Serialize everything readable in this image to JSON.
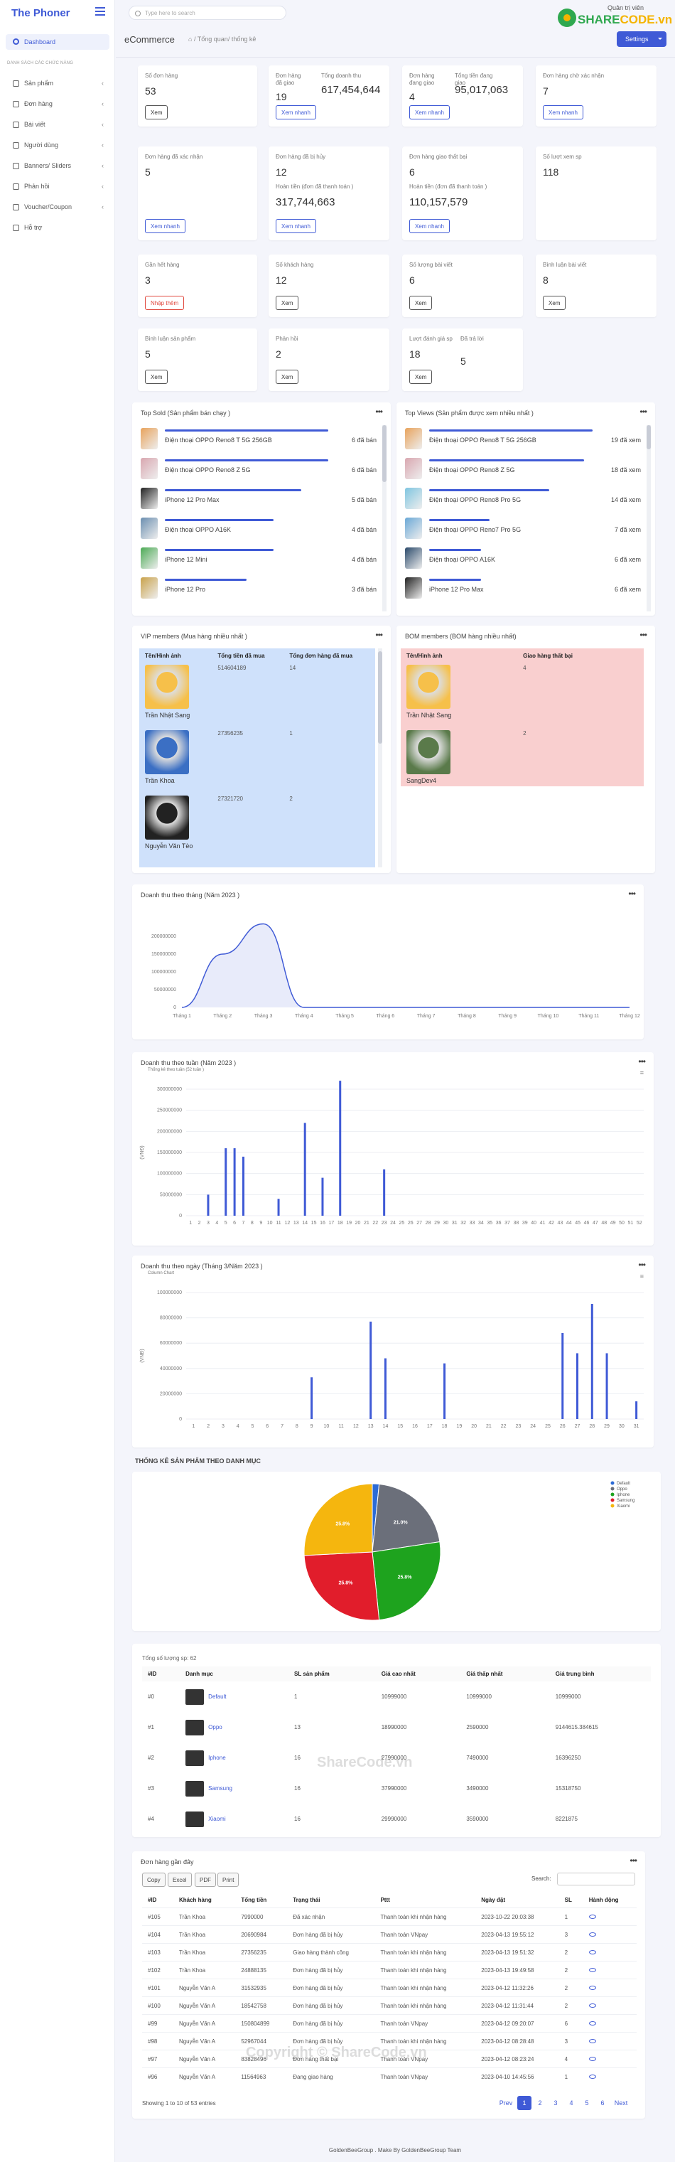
{
  "brand": "The Phoner",
  "search_placeholder": "Type here to search",
  "logo": {
    "top": "Quản trị viên",
    "left": "SHARE",
    "right": "CODE.vn"
  },
  "sidebar": {
    "dashboard": "Dashboard",
    "heading": "Danh sách các chức năng",
    "items": [
      {
        "label": "Sản phẩm",
        "chev": true
      },
      {
        "label": "Đơn hàng",
        "chev": true
      },
      {
        "label": "Bài viết",
        "chev": true
      },
      {
        "label": "Người dùng",
        "chev": true
      },
      {
        "label": "Banners/ Sliders",
        "chev": true
      },
      {
        "label": "Phản hồi",
        "chev": true
      },
      {
        "label": "Voucher/Coupon",
        "chev": true
      },
      {
        "label": "Hỗ trợ",
        "chev": false
      }
    ]
  },
  "header": {
    "title": "eCommerce",
    "crumb": "Tổng quan/ thống kê",
    "settings": "Settings"
  },
  "stats": [
    {
      "label": "Số đơn hàng",
      "value": "53",
      "btn": "Xem",
      "btn_style": "dark"
    },
    {
      "label": "Đơn hàng\nđã giao",
      "value": "19",
      "label2": "Tổng doanh thu",
      "value2": "617,454,644",
      "btn": "Xem nhanh",
      "btn_style": "blue"
    },
    {
      "label": "Đơn hàng\nđang giao",
      "value": "4",
      "label2": "Tổng tiền đang\ngiao",
      "value2": "95,017,063",
      "btn": "Xem nhanh",
      "btn_style": "blue"
    },
    {
      "label": "Đơn hàng chờ xác nhận",
      "value": "7",
      "btn": "Xem nhanh",
      "btn_style": "blue"
    },
    {
      "label": "Đơn hàng đã xác nhận",
      "value": "5",
      "btn": "Xem nhanh",
      "btn_style": "blue"
    },
    {
      "label": "Đơn hàng đã bị hủy",
      "value": "12",
      "label2": "Hoàn tiền (đơn đã thanh toán )",
      "value2": "317,744,663",
      "btn": "Xem nhanh",
      "btn_style": "blue"
    },
    {
      "label": "Đơn hàng giao thất bại",
      "value": "6",
      "label2": "Hoàn tiền (đơn đã thanh toán )",
      "value2": "110,157,579",
      "btn": "Xem nhanh",
      "btn_style": "blue"
    },
    {
      "label": "Số lượt xem sp",
      "value": "118"
    },
    {
      "label": "Gần hết hàng",
      "value": "3",
      "btn": "Nhập thêm",
      "btn_style": "red"
    },
    {
      "label": "Số khách hàng",
      "value": "12",
      "btn": "Xem",
      "btn_style": "dark"
    },
    {
      "label": "Số lượng bài viết",
      "value": "6",
      "btn": "Xem",
      "btn_style": "dark"
    },
    {
      "label": "Bình luận bài viết",
      "value": "8",
      "btn": "Xem",
      "btn_style": "dark"
    },
    {
      "label": "Bình luận sản phẩm",
      "value": "5",
      "btn": "Xem",
      "btn_style": "dark"
    },
    {
      "label": "Phản hồi",
      "value": "2",
      "btn": "Xem",
      "btn_style": "dark"
    },
    {
      "label": "Lượt đánh giá sp",
      "value": "18",
      "label2": "Đã trả lời",
      "value2": "5",
      "btn": "Xem",
      "btn_style": "dark"
    }
  ],
  "top_sold": {
    "title": "Top Sold (Sản phẩm bán chạy )",
    "unit": "đã bán",
    "items": [
      {
        "name": "Điện thoại OPPO Reno8 T 5G 256GB",
        "value": 6,
        "label": "6 đã bán",
        "color": "#e8a35c"
      },
      {
        "name": "Điện thoại OPPO Reno8 Z 5G",
        "value": 6,
        "label": "6 đã bán",
        "color": "#d9a7b0"
      },
      {
        "name": "iPhone 12 Pro Max",
        "value": 5,
        "label": "5 đã bán",
        "color": "#222"
      },
      {
        "name": "Điện thoại OPPO A16K",
        "value": 4,
        "label": "4 đã bán",
        "color": "#6b8fb0"
      },
      {
        "name": "iPhone 12 Mini",
        "value": 4,
        "label": "4 đã bán",
        "color": "#4caa55"
      },
      {
        "name": "iPhone 12 Pro",
        "value": 3,
        "label": "3 đã bán",
        "color": "#c9a24a"
      }
    ]
  },
  "top_views": {
    "title": "Top Views (Sản phẩm được xem nhiều nhất )",
    "items": [
      {
        "name": "Điện thoại OPPO Reno8 T 5G 256GB",
        "value": 19,
        "label": "19 đã xem",
        "color": "#e8a35c"
      },
      {
        "name": "Điện thoại OPPO Reno8 Z 5G",
        "value": 18,
        "label": "18 đã xem",
        "color": "#d9a7b0"
      },
      {
        "name": "Điện thoại OPPO Reno8 Pro 5G",
        "value": 14,
        "label": "14 đã xem",
        "color": "#7fc5e0"
      },
      {
        "name": "Điện thoại OPPO Reno7 Pro 5G",
        "value": 7,
        "label": "7 đã xem",
        "color": "#6aa8d6"
      },
      {
        "name": "Điện thoại OPPO A16K",
        "value": 6,
        "label": "6 đã xem",
        "color": "#2b4a6b"
      },
      {
        "name": "iPhone 12 Pro Max",
        "value": 6,
        "label": "6 đã xem",
        "color": "#222"
      }
    ]
  },
  "vip": {
    "title": "VIP members (Mua hàng nhiều nhất )",
    "cols": [
      "Tên/Hình ảnh",
      "Tổng tiền đã mua",
      "Tổng đơn hàng đã mua"
    ],
    "rows": [
      {
        "name": "Trần Nhật Sang",
        "total": "514604189",
        "orders": "14",
        "avatar": "#f6c04a"
      },
      {
        "name": "Trần Khoa",
        "total": "27356235",
        "orders": "1",
        "avatar": "#3b6fc4"
      },
      {
        "name": "Nguyễn Văn Tèo",
        "total": "27321720",
        "orders": "2",
        "avatar": "#222"
      }
    ]
  },
  "bom": {
    "title": "BOM members (BOM hàng nhiều nhất)",
    "cols": [
      "Tên/Hình ảnh",
      "Giao hàng thất bại"
    ],
    "rows": [
      {
        "name": "Trần Nhật Sang",
        "count": "4",
        "avatar": "#f6c04a"
      },
      {
        "name": "SangDev4",
        "count": "2",
        "avatar": "#5a7a4a"
      }
    ]
  },
  "monthly": {
    "title": "Doanh thu theo tháng (Năm 2023 )"
  },
  "weekly": {
    "title": "Doanh thu theo tuần (Năm 2023 )",
    "subtitle": "Thống kê theo tuần (52 tuần )"
  },
  "daily": {
    "title": "Doanh thu theo ngày (Tháng 3/Năm 2023 )",
    "subtitle": "Column Chart"
  },
  "category": {
    "section_title": "THỐNG KÊ SẢN PHẨM THEO DANH MỤC",
    "total": "Tổng số lượng sp: 62",
    "cols": [
      "#ID",
      "Danh mục",
      "SL sản phẩm",
      "Giá cao nhất",
      "Giá thấp nhất",
      "Giá trung bình"
    ],
    "rows": [
      {
        "id": "#0",
        "name": "Default",
        "qty": "1",
        "max": "10999000",
        "min": "10999000",
        "avg": "10999000"
      },
      {
        "id": "#1",
        "name": "Oppo",
        "qty": "13",
        "max": "18990000",
        "min": "2590000",
        "avg": "9144615.384615"
      },
      {
        "id": "#2",
        "name": "Iphone",
        "qty": "16",
        "max": "27990000",
        "min": "7490000",
        "avg": "16396250"
      },
      {
        "id": "#3",
        "name": "Samsung",
        "qty": "16",
        "max": "37990000",
        "min": "3490000",
        "avg": "15318750"
      },
      {
        "id": "#4",
        "name": "Xiaomi",
        "qty": "16",
        "max": "29990000",
        "min": "3590000",
        "avg": "8221875"
      }
    ]
  },
  "orders": {
    "title": "Đơn hàng gần đây",
    "export": [
      "Copy",
      "Excel",
      "PDF",
      "Print"
    ],
    "search_label": "Search:",
    "cols": [
      "#ID",
      "Khách hàng",
      "Tổng tiền",
      "Trạng thái",
      "Pttt",
      "Ngày đặt",
      "SL",
      "Hành động"
    ],
    "rows": [
      {
        "id": "#105",
        "customer": "Trần Khoa",
        "total": "7990000",
        "status": "Đã xác nhận",
        "status_class": "status-orange",
        "pay": "Thanh toán khi nhận hàng",
        "date": "2023-10-22 20:03:38",
        "qty": "1"
      },
      {
        "id": "#104",
        "customer": "Trần Khoa",
        "total": "20690984",
        "status": "Đơn hàng đã bị hủy",
        "status_class": "status-red",
        "pay": "Thanh toán VNpay",
        "date": "2023-04-13 19:55:12",
        "qty": "3"
      },
      {
        "id": "#103",
        "customer": "Trần Khoa",
        "total": "27356235",
        "status": "Giao hàng thành công",
        "status_class": "status-green",
        "pay": "Thanh toán khi nhận hàng",
        "date": "2023-04-13 19:51:32",
        "qty": "2"
      },
      {
        "id": "#102",
        "customer": "Trần Khoa",
        "total": "24888135",
        "status": "Đơn hàng đã bị hủy",
        "status_class": "status-red",
        "pay": "Thanh toán khi nhận hàng",
        "date": "2023-04-13 19:49:58",
        "qty": "2"
      },
      {
        "id": "#101",
        "customer": "Nguyễn Văn A",
        "total": "31532935",
        "status": "Đơn hàng đã bị hủy",
        "status_class": "status-red",
        "pay": "Thanh toán khi nhận hàng",
        "date": "2023-04-12 11:32:26",
        "qty": "2"
      },
      {
        "id": "#100",
        "customer": "Nguyễn Văn A",
        "total": "18542758",
        "status": "Đơn hàng đã bị hủy",
        "status_class": "status-red",
        "pay": "Thanh toán khi nhận hàng",
        "date": "2023-04-12 11:31:44",
        "qty": "2"
      },
      {
        "id": "#99",
        "customer": "Nguyễn Văn A",
        "total": "150804899",
        "status": "Đơn hàng đã bị hủy",
        "status_class": "status-red",
        "pay": "Thanh toán VNpay",
        "date": "2023-04-12 09:20:07",
        "qty": "6"
      },
      {
        "id": "#98",
        "customer": "Nguyễn Văn A",
        "total": "52967044",
        "status": "Đơn hàng đã bị hủy",
        "status_class": "status-red",
        "pay": "Thanh toán khi nhận hàng",
        "date": "2023-04-12 08:28:48",
        "qty": "3"
      },
      {
        "id": "#97",
        "customer": "Nguyễn Văn A",
        "total": "83828496",
        "status": "Đơn hàng thất bại",
        "status_class": "status-red",
        "pay": "Thanh toán VNpay",
        "date": "2023-04-12 08:23:24",
        "qty": "4"
      },
      {
        "id": "#96",
        "customer": "Nguyễn Văn A",
        "total": "11564963",
        "status": "Đang giao hàng",
        "status_class": "status-orange",
        "pay": "Thanh toán VNpay",
        "date": "2023-04-10 14:45:56",
        "qty": "1"
      }
    ],
    "info": "Showing 1 to 10 of 53 entries",
    "pages": [
      "Prev",
      "1",
      "2",
      "3",
      "4",
      "5",
      "6",
      "Next"
    ]
  },
  "footer": "GoldenBeeGroup . Make By GoldenBeeGroup Team",
  "watermarks": [
    "ShareCode.vn",
    "Copyright © ShareCode.vn"
  ],
  "chart_data": [
    {
      "type": "area",
      "title": "Doanh thu theo tháng (Năm 2023 )",
      "categories": [
        "Tháng 1",
        "Tháng 2",
        "Tháng 3",
        "Tháng 4",
        "Tháng 5",
        "Tháng 6",
        "Tháng 7",
        "Tháng 8",
        "Tháng 9",
        "Tháng 10",
        "Tháng 11",
        "Tháng 12"
      ],
      "values": [
        0,
        150000000,
        235000000,
        0,
        0,
        0,
        0,
        0,
        0,
        0,
        0,
        0
      ],
      "yticks": [
        "0",
        "50000000",
        "100000000",
        "150000000",
        "200000000"
      ],
      "ylim": [
        0,
        250000000
      ],
      "color": "#3f5ad6"
    },
    {
      "type": "bar",
      "title": "Doanh thu theo tuần (Năm 2023 )",
      "subtitle": "Thống kê theo tuần (52 tuần )",
      "ylabel": "(VNĐ)",
      "categories": [
        "1",
        "2",
        "3",
        "4",
        "5",
        "6",
        "7",
        "8",
        "9",
        "10",
        "11",
        "12",
        "13",
        "14",
        "15",
        "16",
        "17",
        "18",
        "19",
        "20",
        "21",
        "22",
        "23",
        "24",
        "25",
        "26",
        "27",
        "28",
        "29",
        "30",
        "31",
        "32",
        "33",
        "34",
        "35",
        "36",
        "37",
        "38",
        "39",
        "40",
        "41",
        "42",
        "43",
        "44",
        "45",
        "46",
        "47",
        "48",
        "49",
        "50",
        "51",
        "52"
      ],
      "values": [
        0,
        0,
        50000000,
        0,
        160000000,
        160000000,
        140000000,
        0,
        0,
        0,
        40000000,
        0,
        0,
        220000000,
        0,
        90000000,
        0,
        320000000,
        0,
        0,
        0,
        0,
        110000000,
        0,
        0,
        0,
        0,
        0,
        0,
        0,
        0,
        0,
        0,
        0,
        0,
        0,
        0,
        0,
        0,
        0,
        0,
        0,
        0,
        0,
        0,
        0,
        0,
        0,
        0,
        0,
        0,
        0
      ],
      "ylim": [
        0,
        300000000
      ],
      "yticks": [
        "0",
        "50000000",
        "100000000",
        "150000000",
        "200000000",
        "250000000",
        "300000000"
      ],
      "color": "#3f5ad6"
    },
    {
      "type": "bar",
      "title": "Doanh thu theo ngày (Tháng 3/Năm 2023 )",
      "subtitle": "Column Chart",
      "ylabel": "(VNĐ)",
      "categories": [
        "1",
        "2",
        "3",
        "4",
        "5",
        "6",
        "7",
        "8",
        "9",
        "10",
        "11",
        "12",
        "13",
        "14",
        "15",
        "16",
        "17",
        "18",
        "19",
        "20",
        "21",
        "22",
        "23",
        "24",
        "25",
        "26",
        "27",
        "28",
        "29",
        "30",
        "31"
      ],
      "values": [
        0,
        0,
        0,
        0,
        0,
        0,
        0,
        0,
        33000000,
        0,
        0,
        0,
        77000000,
        48000000,
        0,
        0,
        0,
        44000000,
        0,
        0,
        0,
        0,
        0,
        0,
        0,
        68000000,
        52000000,
        91000000,
        52000000,
        0,
        14000000
      ],
      "ylim": [
        0,
        100000000
      ],
      "yticks": [
        "0",
        "20000000",
        "40000000",
        "60000000",
        "80000000",
        "100000000"
      ],
      "color": "#3f5ad6"
    },
    {
      "type": "pie",
      "title": "THỐNG KÊ SẢN PHẨM THEO DANH MỤC",
      "categories": [
        "Default",
        "Oppo",
        "Iphone",
        "Samsung",
        "Xiaomi"
      ],
      "values": [
        1.6,
        21.0,
        25.8,
        25.8,
        25.8
      ],
      "labels": [
        "",
        "21.0%",
        "25.8%",
        "25.8%",
        "25.8%"
      ],
      "colors": [
        "#2c6bd6",
        "#6b6f7a",
        "#1ea31e",
        "#e11d2b",
        "#f5b60e"
      ]
    }
  ]
}
